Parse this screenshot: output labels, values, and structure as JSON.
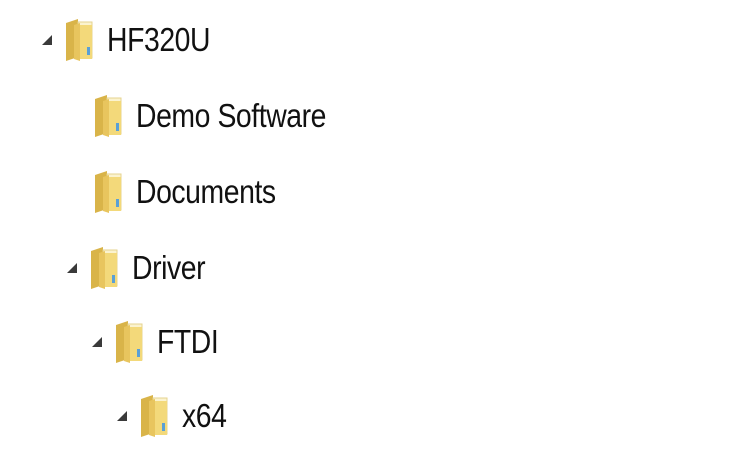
{
  "tree": {
    "items": [
      {
        "label": "HF320U",
        "expanded": true,
        "icon": "folder-icon"
      },
      {
        "label": "Demo Software",
        "expanded": false,
        "icon": "folder-icon"
      },
      {
        "label": "Documents",
        "expanded": false,
        "icon": "folder-icon"
      },
      {
        "label": "Driver",
        "expanded": true,
        "icon": "folder-icon"
      },
      {
        "label": "FTDI",
        "expanded": true,
        "icon": "folder-icon"
      },
      {
        "label": "x64",
        "expanded": true,
        "icon": "folder-icon"
      }
    ]
  },
  "colors": {
    "folder_front": "#f3d97a",
    "folder_back": "#d9b449",
    "folder_paper": "#fbf3cf",
    "folder_accent": "#5aa0d6",
    "expander": "#3a3a3a",
    "text": "#111111"
  }
}
